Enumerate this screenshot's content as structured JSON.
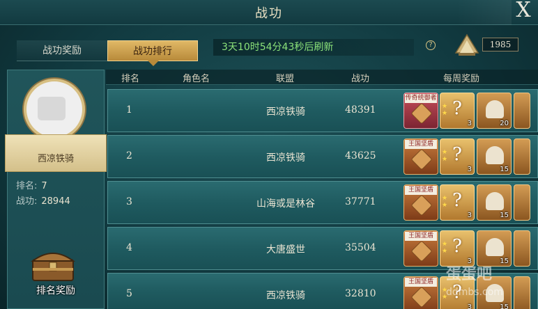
{
  "window": {
    "title": "战功",
    "close_glyph": "X"
  },
  "tabs": [
    {
      "label": "战功奖励",
      "active": false
    },
    {
      "label": "战功排行",
      "active": true
    }
  ],
  "refresh_text": "3天10时54分43秒后刷新",
  "help_glyph": "?",
  "merit_total": "1985",
  "player": {
    "name": "西凉铁骑",
    "rank_label": "排名:",
    "rank_value": "7",
    "merit_label": "战功:",
    "merit_value": "28944"
  },
  "rank_reward_label": "排名奖励",
  "table": {
    "headers": [
      "排名",
      "角色名",
      "联盟",
      "战功",
      "每周奖励"
    ],
    "rows": [
      {
        "rank": "1",
        "role": "",
        "alliance": "西凉铁骑",
        "merit": "48391",
        "rewards": [
          {
            "tag": "传奇统御者",
            "count": ""
          },
          {
            "tag": "",
            "count": "3"
          },
          {
            "tag": "",
            "count": "20"
          }
        ]
      },
      {
        "rank": "2",
        "role": "",
        "alliance": "西凉铁骑",
        "merit": "43625",
        "rewards": [
          {
            "tag": "王国坚盾",
            "count": ""
          },
          {
            "tag": "",
            "count": "3"
          },
          {
            "tag": "",
            "count": "15"
          }
        ]
      },
      {
        "rank": "3",
        "role": "",
        "alliance": "山海或是林谷",
        "merit": "37771",
        "rewards": [
          {
            "tag": "王国坚盾",
            "count": ""
          },
          {
            "tag": "",
            "count": "3"
          },
          {
            "tag": "",
            "count": "15"
          }
        ]
      },
      {
        "rank": "4",
        "role": "",
        "alliance": "大唐盛世",
        "merit": "35504",
        "rewards": [
          {
            "tag": "王国坚盾",
            "count": ""
          },
          {
            "tag": "",
            "count": "3"
          },
          {
            "tag": "",
            "count": "15"
          }
        ]
      },
      {
        "rank": "5",
        "role": "",
        "alliance": "西凉铁骑",
        "merit": "32810",
        "rewards": [
          {
            "tag": "王国坚盾",
            "count": ""
          },
          {
            "tag": "",
            "count": "3"
          },
          {
            "tag": "",
            "count": "15"
          }
        ]
      }
    ]
  },
  "watermark": {
    "text": "蛋蛋吧",
    "url": "ddmbs.com"
  },
  "colors": {
    "accent_gold": "#e0b866",
    "timer_green": "#8ce37a",
    "panel_teal": "#1f5b60"
  },
  "icons": [
    "close-icon",
    "help-icon",
    "merit-crest-icon",
    "treasure-chest-icon",
    "avatar-icon"
  ]
}
